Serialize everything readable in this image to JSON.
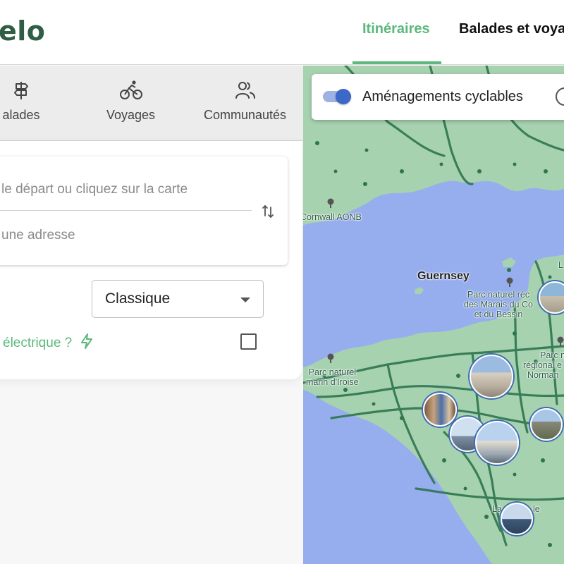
{
  "header": {
    "logo_text": "elo",
    "nav": [
      {
        "label": "Itinéraires",
        "active": true
      },
      {
        "label": "Balades et voya",
        "active": false
      }
    ],
    "accent_color": "#5cb87c",
    "logo_color": "#2f5e44"
  },
  "modes": [
    {
      "label": "alades",
      "icon": "signpost-icon"
    },
    {
      "label": "Voyages",
      "icon": "cyclist-icon"
    },
    {
      "label": "Communautés",
      "icon": "users-icon"
    }
  ],
  "route_form": {
    "start_placeholder": "le départ ou cliquez sur la carte",
    "end_placeholder": "une adresse",
    "swap_icon": "swap-arrows-icon",
    "profile_select": {
      "value": "Classique"
    },
    "electric": {
      "label": "électrique ?",
      "icon": "lightning-icon",
      "checked": false
    }
  },
  "map": {
    "layer_toggle": {
      "label": "Aménagements cyclables",
      "on": true,
      "toggle_color": "#3c69c8"
    },
    "labels": {
      "cornwall": "Cornwall AONB",
      "guernsey": "Guernsey",
      "marais_1": "Parc naturel réc",
      "marais_2": "des Marais du Co",
      "marais_3": "et du Bessin",
      "iroise_1": "Parc naturel",
      "iroise_2": "marin d'Iroise",
      "normandie_1": "Parc n",
      "normandie_2": "régional e",
      "normandie_3": "Norman",
      "top_right": "L",
      "bottom": "La",
      "bottom_2": "le"
    },
    "colors": {
      "sea": "#97aeee",
      "land": "#a7d2b0",
      "cycle_network": "#2f7450"
    }
  }
}
